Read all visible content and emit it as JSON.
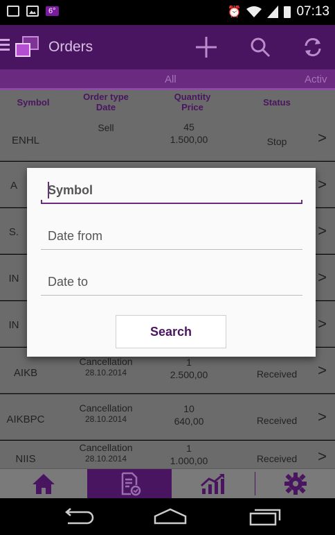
{
  "status_bar": {
    "temp_badge": "6°",
    "time": "07:13"
  },
  "app_bar": {
    "title": "Orders"
  },
  "tabs": [
    {
      "label": "All"
    },
    {
      "label": "Activ"
    }
  ],
  "table": {
    "headers": {
      "symbol": "Symbol",
      "order_type": "Order type",
      "date": "Date",
      "quantity": "Quantity",
      "price": "Price",
      "status": "Status"
    },
    "rows": [
      {
        "symbol": "ENHL",
        "type": "Sell",
        "date": "",
        "quantity": "45",
        "price": "1.500,00",
        "status": "Stop"
      },
      {
        "symbol": "A",
        "type": "",
        "date": "",
        "quantity": "",
        "price": "",
        "status": ""
      },
      {
        "symbol": "S.",
        "type": "",
        "date": "",
        "quantity": "",
        "price": "",
        "status": ""
      },
      {
        "symbol": "IN",
        "type": "",
        "date": "",
        "quantity": "",
        "price": "",
        "status": ""
      },
      {
        "symbol": "IN",
        "type": "",
        "date": "",
        "quantity": "",
        "price": "",
        "status": ""
      },
      {
        "symbol": "AIKB",
        "type": "Cancellation",
        "date": "28.10.2014",
        "quantity": "1",
        "price": "2.500,00",
        "status": "Received"
      },
      {
        "symbol": "AIKBPC",
        "type": "Cancellation",
        "date": "28.10.2014",
        "quantity": "10",
        "price": "640,00",
        "status": "Received"
      },
      {
        "symbol": "NIIS",
        "type": "Cancellation",
        "date": "28.10.2014",
        "quantity": "1",
        "price": "1.000,00",
        "status": "Received"
      }
    ]
  },
  "dialog": {
    "symbol_placeholder": "Symbol",
    "date_from_placeholder": "Date from",
    "date_to_placeholder": "Date to",
    "search_label": "Search"
  },
  "colors": {
    "brand_dark": "#4a1560",
    "brand": "#6a2a80"
  },
  "icons": {
    "home": "home-icon",
    "orders": "orders-document-icon",
    "chart": "chart-icon",
    "settings": "gear-icon"
  }
}
